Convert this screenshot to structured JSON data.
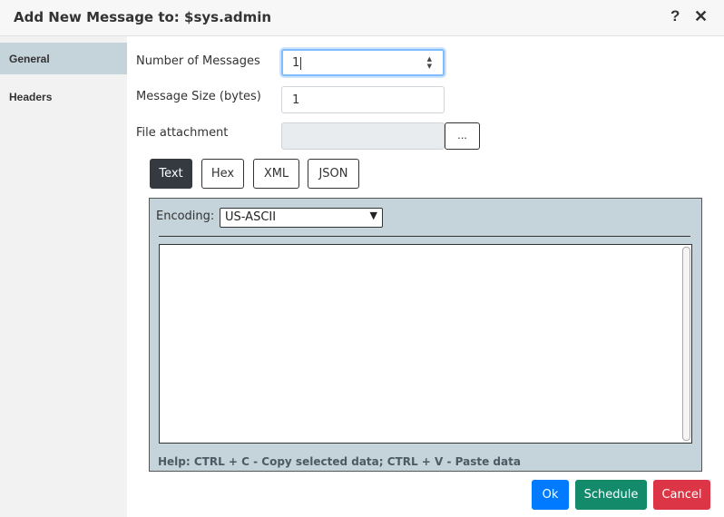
{
  "dialog": {
    "title": "Add New Message to: $sys.admin",
    "help_icon": "?",
    "close_icon": "✕"
  },
  "sidebar": {
    "items": [
      {
        "label": "General",
        "active": true
      },
      {
        "label": "Headers",
        "active": false
      }
    ]
  },
  "form": {
    "num_messages_label": "Number of Messages",
    "num_messages_value": "1",
    "message_size_label": "Message Size (bytes)",
    "message_size_value": "1",
    "file_attachment_label": "File attachment",
    "file_attachment_value": "",
    "browse_label": "..."
  },
  "formats": {
    "options": [
      "Text",
      "Hex",
      "XML",
      "JSON"
    ],
    "selected": "Text"
  },
  "editor": {
    "encoding_label": "Encoding:",
    "encoding_value": "US-ASCII",
    "content": "",
    "help_text": "Help: CTRL + C - Copy selected data; CTRL + V - Paste data"
  },
  "actions": {
    "ok_label": "Ok",
    "schedule_label": "Schedule",
    "cancel_label": "Cancel"
  },
  "colors": {
    "ok": "#007bff",
    "schedule": "#138b6b",
    "cancel": "#dc3545",
    "sidebar_active": "#c5d3da",
    "editor_panel": "#c5d3da"
  },
  "icons": {
    "help": "question-mark-icon",
    "close": "close-icon",
    "spinner": "spinner-arrows-icon",
    "dropdown": "chevron-down-icon"
  }
}
